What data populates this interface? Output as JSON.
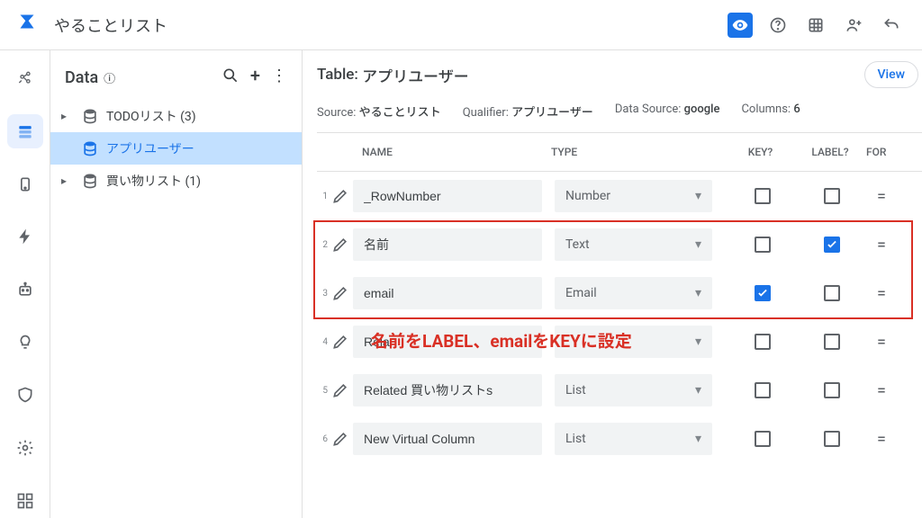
{
  "header": {
    "app_title": "やることリスト"
  },
  "left_panel": {
    "title": "Data",
    "items": [
      {
        "label": "TODOリスト (3)",
        "selected": false,
        "has_children": true
      },
      {
        "label": "アプリユーザー",
        "selected": true,
        "has_children": false
      },
      {
        "label": "買い物リスト (1)",
        "selected": false,
        "has_children": true
      }
    ]
  },
  "content": {
    "title_prefix": "Table:",
    "title_value": "アプリユーザー",
    "view_btn": "View",
    "meta": {
      "source_label": "Source:",
      "source_value": "やることリスト",
      "qualifier_label": "Qualifier:",
      "qualifier_value": "アプリユーザー",
      "datasource_label": "Data Source:",
      "datasource_value": "google",
      "columns_label": "Columns:",
      "columns_value": "6"
    },
    "columns": {
      "name": "NAME",
      "type": "TYPE",
      "key": "KEY?",
      "label": "LABEL?",
      "formula": "FOR"
    },
    "rows": [
      {
        "num": "1",
        "name": "_RowNumber",
        "type": "Number",
        "key": false,
        "label": false
      },
      {
        "num": "2",
        "name": "名前",
        "type": "Text",
        "key": false,
        "label": true
      },
      {
        "num": "3",
        "name": "email",
        "type": "Email",
        "key": true,
        "label": false
      },
      {
        "num": "4",
        "name": "Rela",
        "type": "",
        "key": false,
        "label": false
      },
      {
        "num": "5",
        "name": "Related 買い物リストs",
        "type": "List",
        "key": false,
        "label": false
      },
      {
        "num": "6",
        "name": "New Virtual Column",
        "type": "List",
        "key": false,
        "label": false
      }
    ],
    "annotation": "名前をLABEL、emailをKEYに設定"
  }
}
